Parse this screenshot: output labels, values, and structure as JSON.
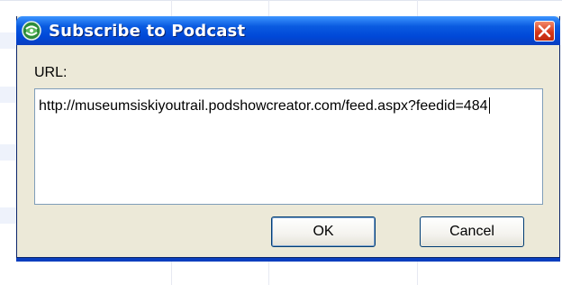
{
  "window": {
    "title": "Subscribe to Podcast"
  },
  "form": {
    "url_label": "URL:",
    "url_value": "http://museumsiskiyoutrail.podshowcreator.com/feed.aspx?feedid=484"
  },
  "buttons": {
    "ok": "OK",
    "cancel": "Cancel"
  },
  "icons": {
    "app": "podcast-globe-icon",
    "close": "close-icon"
  },
  "colors": {
    "titlebar": "#0a5be0",
    "dialog_bg": "#ece9d8",
    "close_button": "#d6381a"
  }
}
